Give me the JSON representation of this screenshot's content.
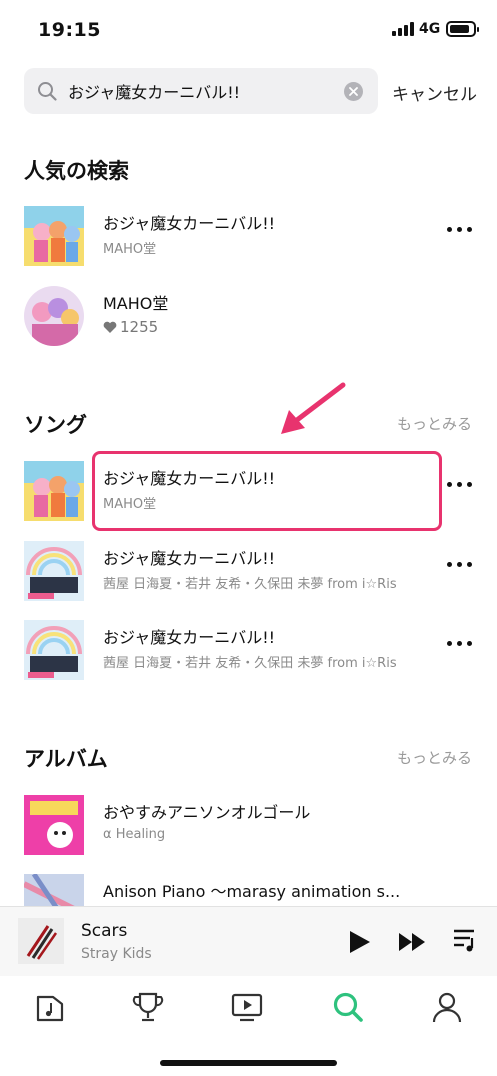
{
  "status_bar": {
    "time": "19:15",
    "network": "4G"
  },
  "search": {
    "query": "おジャ魔女カーニバル!!",
    "cancel_label": "キャンセル"
  },
  "popular": {
    "title": "人気の検索",
    "items": [
      {
        "title": "おジャ魔女カーニバル!!",
        "subtitle": "MAHO堂"
      },
      {
        "title": "MAHO堂",
        "likes": "1255"
      }
    ]
  },
  "songs": {
    "title": "ソング",
    "more_label": "もっとみる",
    "items": [
      {
        "title": "おジャ魔女カーニバル!!",
        "subtitle": "MAHO堂"
      },
      {
        "title": "おジャ魔女カーニバル!!",
        "subtitle": "茜屋 日海夏・若井 友希・久保田 未夢 from i☆Ris"
      },
      {
        "title": "おジャ魔女カーニバル!!",
        "subtitle": "茜屋 日海夏・若井 友希・久保田 未夢 from i☆Ris"
      }
    ]
  },
  "albums": {
    "title": "アルバム",
    "more_label": "もっとみる",
    "items": [
      {
        "title": "おやすみアニソンオルゴール",
        "subtitle": "α Healing"
      },
      {
        "title": "Anison Piano 〜marasy animation s..."
      }
    ]
  },
  "now_playing": {
    "title": "Scars",
    "artist": "Stray Kids"
  },
  "tabs": [
    {
      "name": "home",
      "icon": "music-note-icon",
      "active": false
    },
    {
      "name": "charts",
      "icon": "trophy-icon",
      "active": false
    },
    {
      "name": "video",
      "icon": "video-icon",
      "active": false
    },
    {
      "name": "search",
      "icon": "search-icon",
      "active": true
    },
    {
      "name": "profile",
      "icon": "person-icon",
      "active": false
    }
  ],
  "colors": {
    "accent": "#2ec27e",
    "highlight": "#e8336e"
  }
}
